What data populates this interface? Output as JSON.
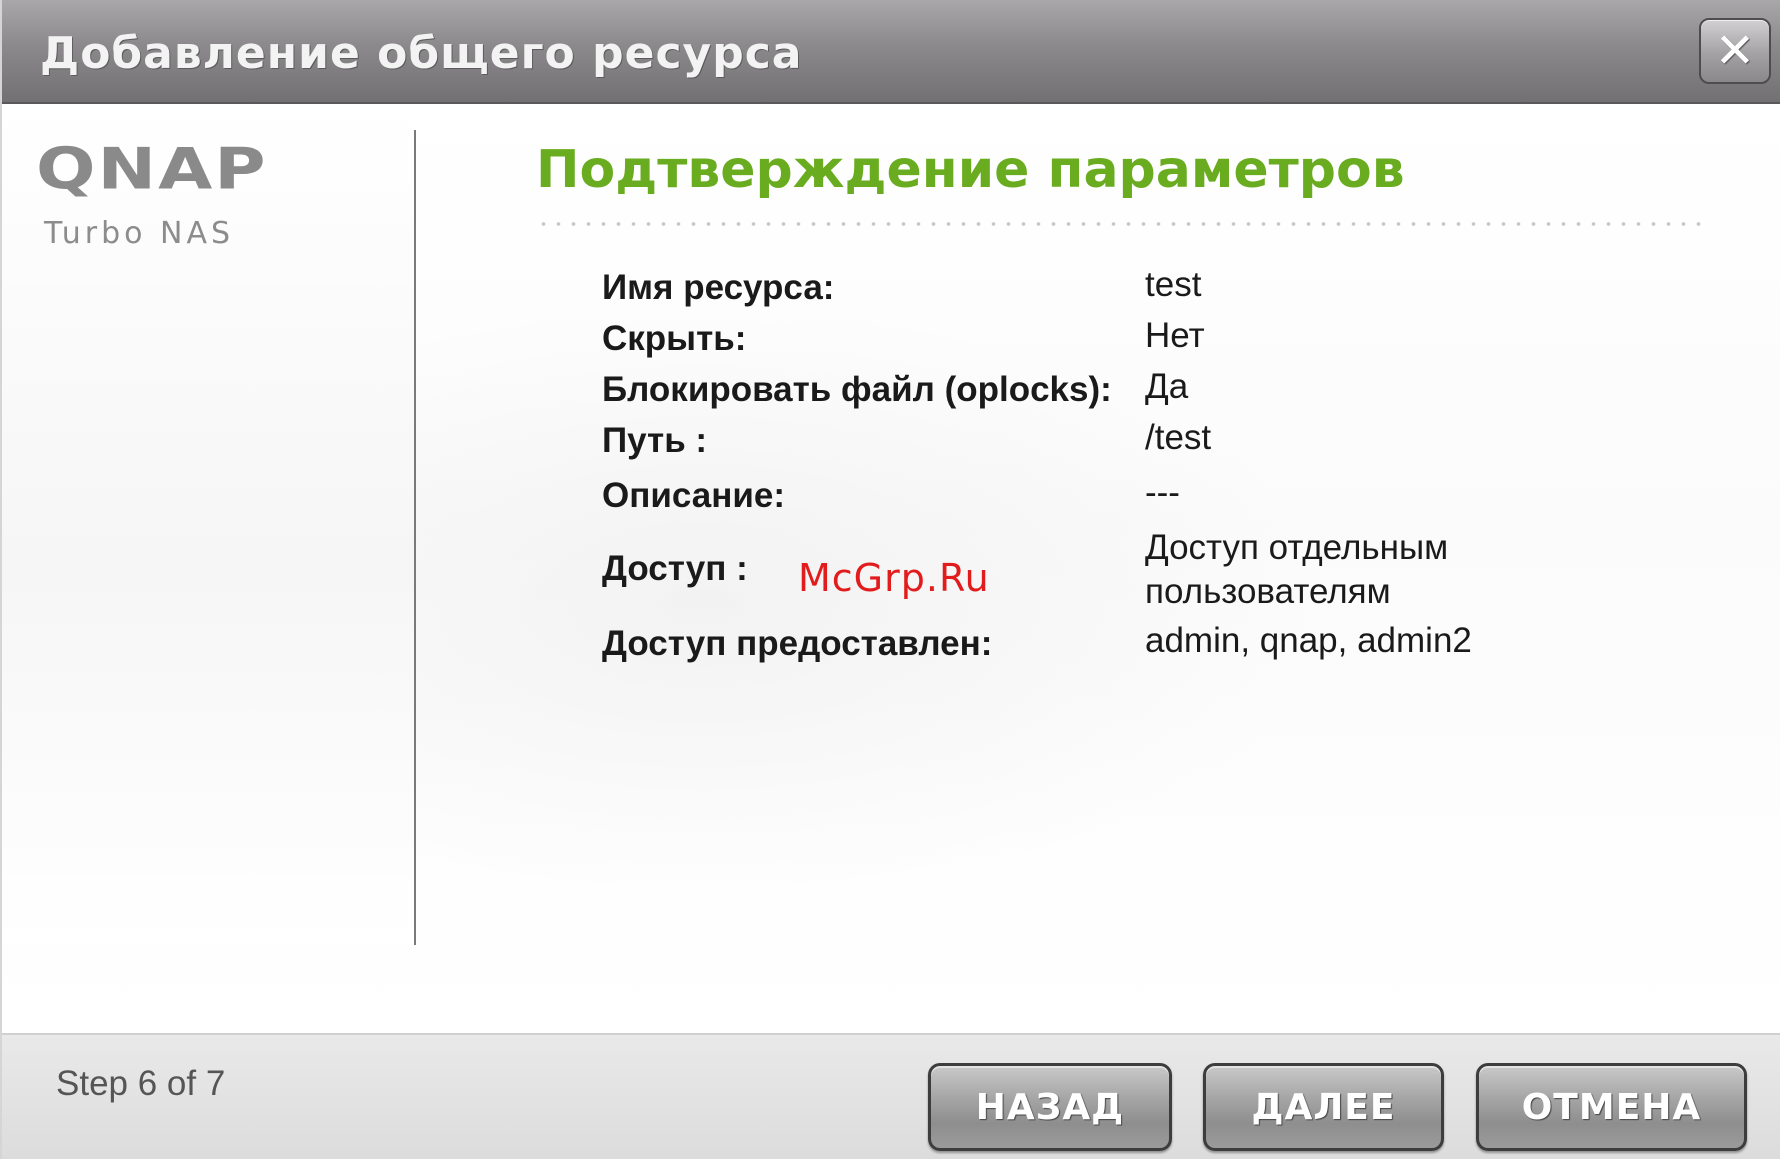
{
  "window": {
    "title": "Добавление общего ресурса",
    "close_label": "✕"
  },
  "logo": {
    "wordmark": "QNAP",
    "subtitle": "Turbo NAS"
  },
  "main": {
    "heading": "Подтверждение параметров",
    "rows": [
      {
        "label": "Имя ресурса:",
        "value": "test"
      },
      {
        "label": "Скрыть:",
        "value": "Нет"
      },
      {
        "label": "Блокировать файл (oplocks):",
        "value": "Да"
      },
      {
        "label": "Путь :",
        "value": "/test"
      },
      {
        "label": "Описание:",
        "value": "---"
      },
      {
        "label": "Доступ :",
        "value_line1": "Доступ отдельным",
        "value_line2": "пользователям"
      },
      {
        "label": "Доступ предоставлен:",
        "value": "admin, qnap, admin2"
      }
    ],
    "watermark": "McGrp.Ru"
  },
  "footer": {
    "step": "Step 6 of 7",
    "back_label": "НАЗАД",
    "next_label": "ДАЛЕЕ",
    "cancel_label": "ОТМЕНА"
  },
  "colors": {
    "heading_green": "#6aac1f",
    "titlebar": "#8b898b",
    "watermark_red": "#e21c1c"
  }
}
